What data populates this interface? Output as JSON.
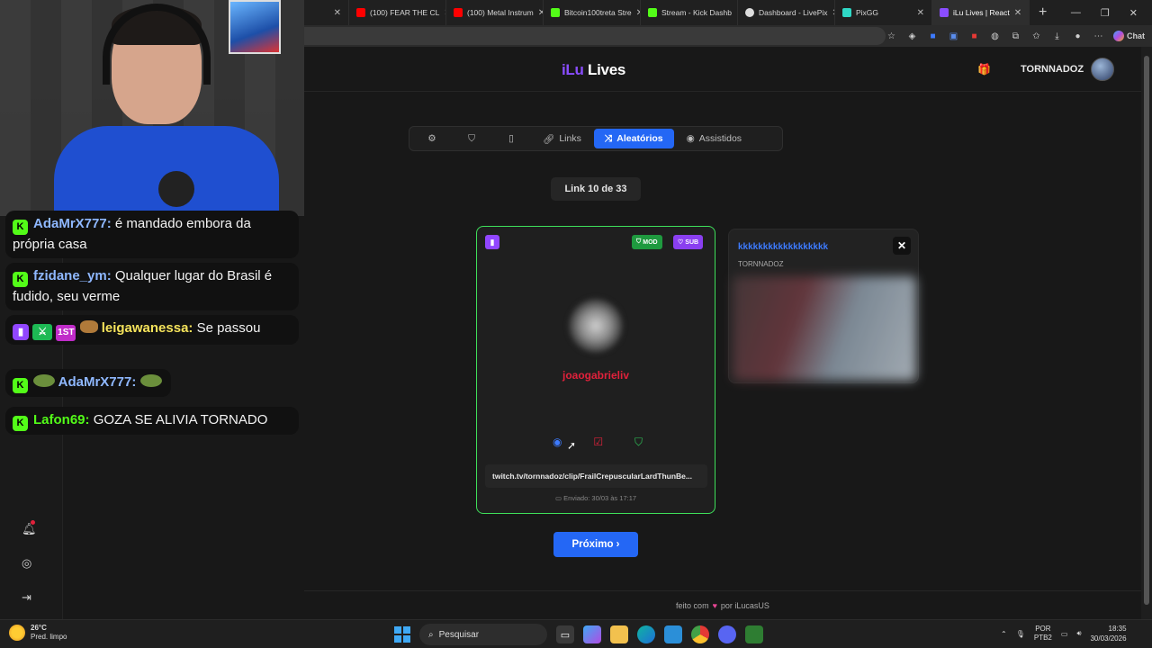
{
  "browser": {
    "tabs": [
      {
        "label": "",
        "color": "#444",
        "partial": true
      },
      {
        "label": "(100) FEAR THE CL",
        "color": "#ff0000"
      },
      {
        "label": "(100) Metal Instrum",
        "color": "#ff0000"
      },
      {
        "label": "Bitcoin100treta Stre",
        "color": "#53fc18"
      },
      {
        "label": "Stream - Kick Dashb",
        "color": "#53fc18"
      },
      {
        "label": "Dashboard - LivePix",
        "color": "#dddddd"
      },
      {
        "label": "PixGG",
        "color": "#2fd8c6"
      },
      {
        "label": "iLu Lives | React",
        "color": "#8a4dff",
        "active": true
      }
    ],
    "chat_label": "Chat"
  },
  "site": {
    "brand_part1": "iLu",
    "brand_part2": "Lives",
    "username": "TORNNADOZ",
    "nav": {
      "settings_icon": "gear-icon",
      "shield_icon": "shield-icon",
      "tablet_icon": "tablet-icon",
      "links_label": "Links",
      "random_label": "Aleatórios",
      "watched_label": "Assistidos"
    },
    "counter": "Link 10 de 33",
    "card": {
      "badge_mod": "MOD",
      "badge_sub": "SUB",
      "author": "joaogabrieliv",
      "link": "twitch.tv/tornnadoz/clip/FrailCrepuscularLardThunBe...",
      "sent": "Enviado: 30/03 às 17:17"
    },
    "side_card": {
      "title": "kkkkkkkkkkkkkkkkkk",
      "channel": "TORNNADOZ"
    },
    "next_label": "Próximo ›",
    "footer_pre": "feito com",
    "footer_post": "por iLucasUS"
  },
  "chat": [
    {
      "user": "AdaMrX777:",
      "text": "é mandado embora da própria casa",
      "color": "#8fb8ff"
    },
    {
      "user": "fzidane_ym:",
      "text": "Qualquer lugar do Brasil é fudido, seu verme",
      "color": "#8fb8ff"
    },
    {
      "user": "leigawanessa:",
      "text": "Se passou",
      "color": "#f5e35b"
    },
    {
      "user": "AdaMrX777:",
      "text": "",
      "color": "#8fb8ff"
    },
    {
      "user": "Lafon69:",
      "text": "GOZA SE ALIVIA TORNADO",
      "color": "#53fc18"
    }
  ],
  "taskbar": {
    "temp": "26°C",
    "weather": "Pred. limpo",
    "search": "Pesquisar",
    "lang1": "POR",
    "lang2": "PTB2",
    "time": "18:35",
    "date": "30/03/2026"
  }
}
